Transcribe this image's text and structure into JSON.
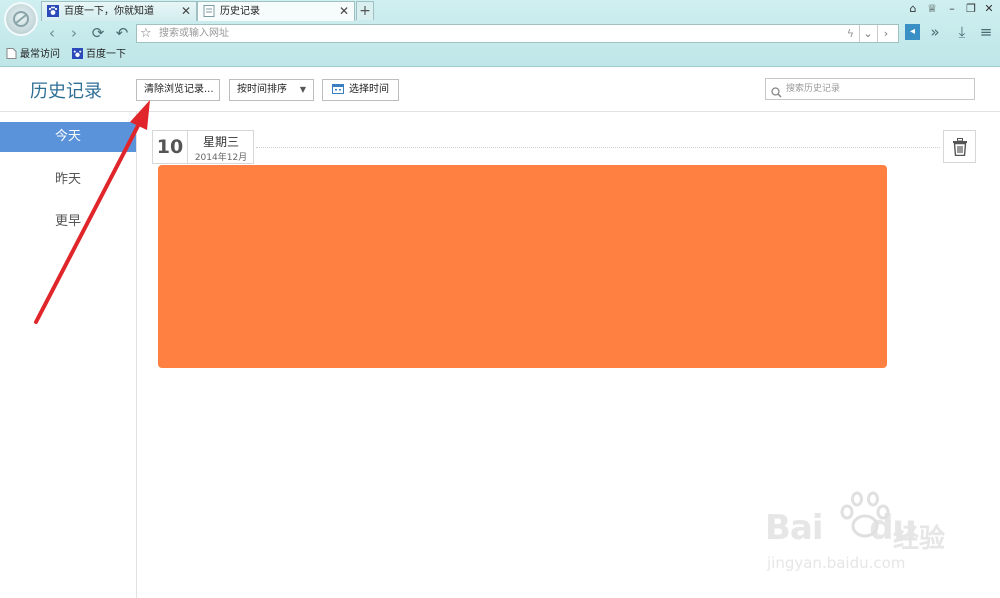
{
  "browser": {
    "tabs": [
      {
        "title": "百度一下，你就知道",
        "active": false
      },
      {
        "title": "历史记录",
        "active": true
      }
    ],
    "address_placeholder": "搜索或输入网址",
    "bookmarks": [
      "最常访问",
      "百度一下"
    ]
  },
  "header": {
    "title": "历史记录",
    "clear_button": "清除浏览记录...",
    "sort_select": "按时间排序",
    "pick_time_button": "选择时间",
    "search_placeholder": "搜索历史记录"
  },
  "sidebar": {
    "items": [
      {
        "label": "今天",
        "active": true
      },
      {
        "label": "昨天",
        "active": false
      },
      {
        "label": "更早",
        "active": false
      }
    ]
  },
  "day": {
    "date": "10",
    "weekday": "星期三",
    "year_month": "2014年12月"
  },
  "colors": {
    "accent": "#5b93da",
    "redacted_block": "#ff8040",
    "annotation_arrow": "#e0262a"
  },
  "watermark": {
    "brand_a": "Bai",
    "brand_b": "du",
    "brand_cn": "经验",
    "url": "jingyan.baidu.com"
  }
}
